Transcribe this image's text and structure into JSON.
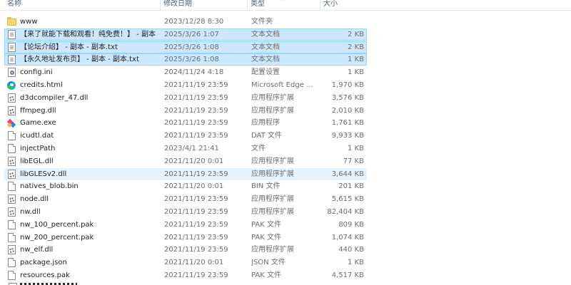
{
  "columns": {
    "name": "名称",
    "date": "修改日期",
    "type": "类型",
    "size": "大小"
  },
  "files": [
    {
      "name": "www",
      "date": "2023/12/28 8:30",
      "type": "文件夹",
      "size": "",
      "icon": "folder-icon",
      "state": "normal"
    },
    {
      "name": "【来了就能下载和观看！纯免费！】 - 副本 - 副本.txt",
      "date": "2025/3/26 1:07",
      "type": "文本文档",
      "size": "2 KB",
      "icon": "text-document-icon",
      "state": "selected"
    },
    {
      "name": "【论坛介绍】 - 副本 - 副本.txt",
      "date": "2025/3/26 1:08",
      "type": "文本文档",
      "size": "2 KB",
      "icon": "text-document-icon",
      "state": "selected"
    },
    {
      "name": "【永久地址发布页】 - 副本 - 副本.txt",
      "date": "2025/3/26 1:08",
      "type": "文本文档",
      "size": "1 KB",
      "icon": "text-document-icon",
      "state": "selected"
    },
    {
      "name": "config.ini",
      "date": "2024/11/24 4:18",
      "type": "配置设置",
      "size": "1 KB",
      "icon": "settings-file-icon",
      "state": "normal"
    },
    {
      "name": "credits.html",
      "date": "2021/11/19 23:59",
      "type": "Microsoft Edge ...",
      "size": "1,970 KB",
      "icon": "edge-icon",
      "state": "normal"
    },
    {
      "name": "d3dcompiler_47.dll",
      "date": "2021/11/19 23:59",
      "type": "应用程序扩展",
      "size": "3,576 KB",
      "icon": "dll-icon",
      "state": "normal"
    },
    {
      "name": "ffmpeg.dll",
      "date": "2021/11/19 23:59",
      "type": "应用程序扩展",
      "size": "2,010 KB",
      "icon": "dll-icon",
      "state": "normal"
    },
    {
      "name": "Game.exe",
      "date": "2021/11/19 23:59",
      "type": "应用程序",
      "size": "1,761 KB",
      "icon": "game-exe-icon",
      "state": "normal"
    },
    {
      "name": "icudtl.dat",
      "date": "2021/11/19 23:59",
      "type": "DAT 文件",
      "size": "9,933 KB",
      "icon": "blank-file-icon",
      "state": "normal"
    },
    {
      "name": "injectPath",
      "date": "2023/4/1 21:41",
      "type": "文件",
      "size": "1 KB",
      "icon": "blank-file-icon",
      "state": "normal"
    },
    {
      "name": "libEGL.dll",
      "date": "2021/11/20 0:01",
      "type": "应用程序扩展",
      "size": "77 KB",
      "icon": "dll-icon",
      "state": "normal"
    },
    {
      "name": "libGLESv2.dll",
      "date": "2021/11/19 23:59",
      "type": "应用程序扩展",
      "size": "3,644 KB",
      "icon": "dll-icon",
      "state": "hover"
    },
    {
      "name": "natives_blob.bin",
      "date": "2021/11/20 0:01",
      "type": "BIN 文件",
      "size": "201 KB",
      "icon": "blank-file-icon",
      "state": "normal"
    },
    {
      "name": "node.dll",
      "date": "2021/11/19 23:59",
      "type": "应用程序扩展",
      "size": "5,615 KB",
      "icon": "dll-icon",
      "state": "normal"
    },
    {
      "name": "nw.dll",
      "date": "2021/11/19 23:59",
      "type": "应用程序扩展",
      "size": "82,404 KB",
      "icon": "dll-icon",
      "state": "normal"
    },
    {
      "name": "nw_100_percent.pak",
      "date": "2021/11/19 23:59",
      "type": "PAK 文件",
      "size": "809 KB",
      "icon": "blank-file-icon",
      "state": "normal"
    },
    {
      "name": "nw_200_percent.pak",
      "date": "2021/11/19 23:59",
      "type": "PAK 文件",
      "size": "1,074 KB",
      "icon": "blank-file-icon",
      "state": "normal"
    },
    {
      "name": "nw_elf.dll",
      "date": "2021/11/19 23:59",
      "type": "应用程序扩展",
      "size": "440 KB",
      "icon": "dll-icon",
      "state": "normal"
    },
    {
      "name": "package.json",
      "date": "2021/11/20 0:01",
      "type": "JSON 文件",
      "size": "1 KB",
      "icon": "blank-file-icon",
      "state": "normal"
    },
    {
      "name": "resources.pak",
      "date": "2021/11/19 23:59",
      "type": "PAK 文件",
      "size": "4,517 KB",
      "icon": "blank-file-icon",
      "state": "normal"
    }
  ],
  "colors": {
    "selected_fill": "#cce8ff",
    "selected_border": "#99d1ff",
    "hover_fill": "#e5f3ff",
    "header_text": "#4c607a",
    "secondary_text": "#6d6d6d"
  }
}
